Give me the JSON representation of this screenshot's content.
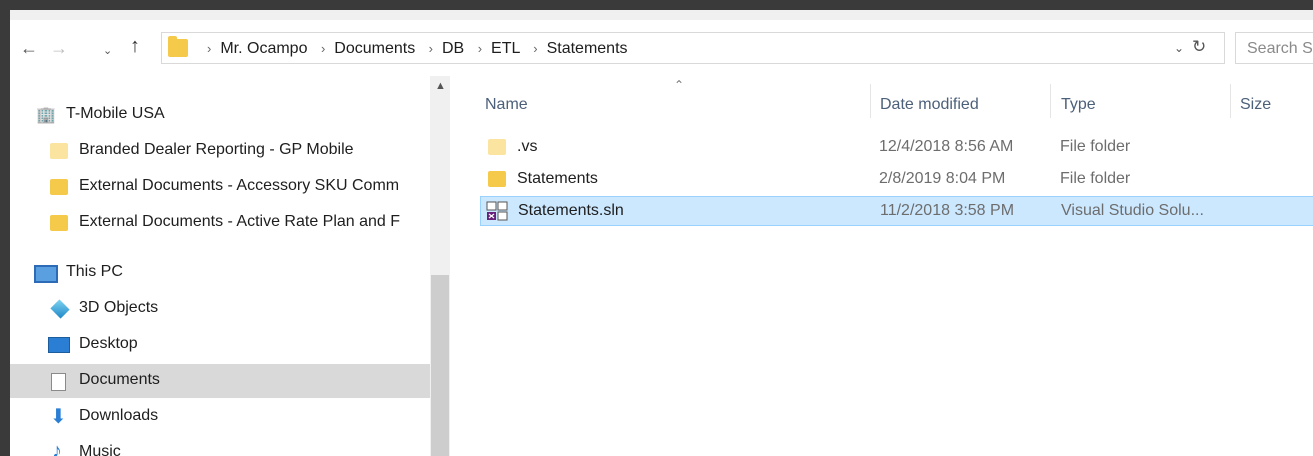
{
  "address_bar": {
    "crumbs": [
      "Mr. Ocampo",
      "Documents",
      "DB",
      "ETL",
      "Statements"
    ],
    "search_placeholder": "Search S"
  },
  "nav_pane": {
    "items": [
      {
        "label": "T-Mobile USA",
        "icon": "building-icon"
      },
      {
        "label": "Branded Dealer Reporting - GP Mobile",
        "icon": "folder-icon"
      },
      {
        "label": "External Documents - Accessory SKU Comm",
        "icon": "folder-icon"
      },
      {
        "label": "External Documents - Active Rate Plan and F",
        "icon": "folder-icon"
      },
      {
        "label": "This PC",
        "icon": "this-pc-icon"
      },
      {
        "label": "3D Objects",
        "icon": "3d-objects-icon"
      },
      {
        "label": "Desktop",
        "icon": "desktop-icon"
      },
      {
        "label": "Documents",
        "icon": "documents-icon",
        "selected": true
      },
      {
        "label": "Downloads",
        "icon": "downloads-icon"
      },
      {
        "label": "Music",
        "icon": "music-icon"
      }
    ]
  },
  "file_list": {
    "columns": [
      "Name",
      "Date modified",
      "Type",
      "Size"
    ],
    "rows": [
      {
        "name": ".vs",
        "date": "12/4/2018 8:56 AM",
        "type": "File folder",
        "icon": "folder-icon"
      },
      {
        "name": "Statements",
        "date": "2/8/2019 8:04 PM",
        "type": "File folder",
        "icon": "folder-icon"
      },
      {
        "name": "Statements.sln",
        "date": "11/2/2018 3:58 PM",
        "type": "Visual Studio Solu...",
        "icon": "visual-studio-solution-icon",
        "selected": true
      }
    ]
  },
  "colors": {
    "selection_bg": "#cce8ff",
    "selection_border": "#99d1ff",
    "folder": "#f5c94a",
    "nav_selected": "#d9d9d9"
  }
}
